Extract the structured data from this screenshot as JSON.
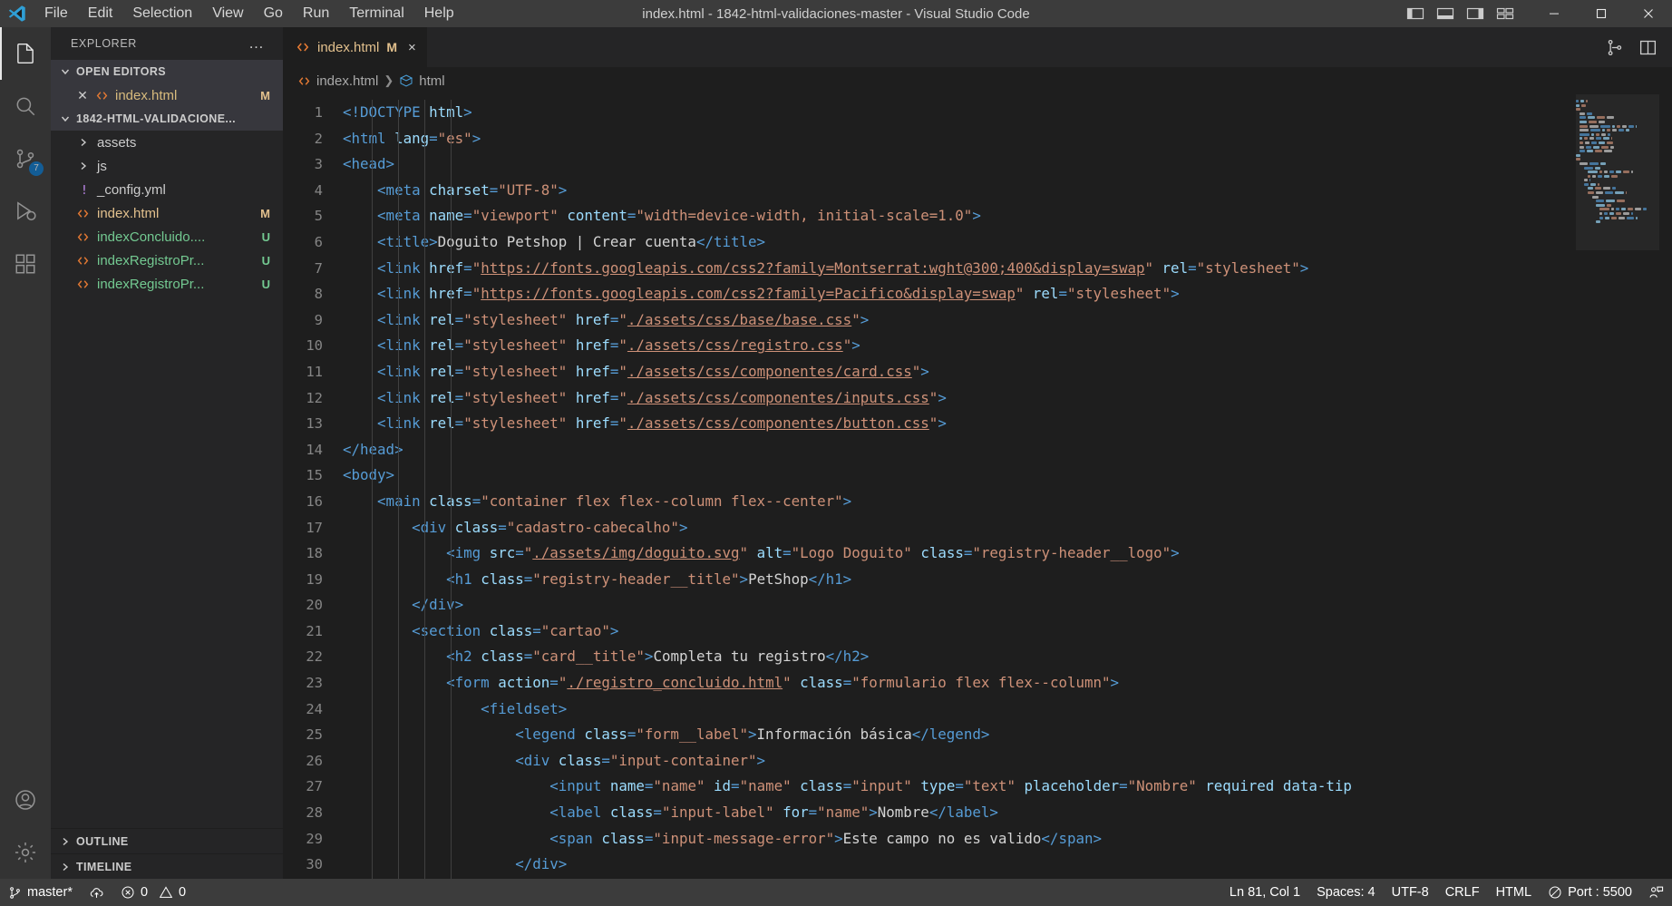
{
  "window": {
    "title": "index.html - 1842-html-validaciones-master - Visual Studio Code",
    "menu": [
      "File",
      "Edit",
      "Selection",
      "View",
      "Go",
      "Run",
      "Terminal",
      "Help"
    ],
    "controls": {
      "minimize": "minimize-icon",
      "maximize": "maximize-icon",
      "close": "close-icon"
    },
    "layout_icons": [
      "toggle-primary-sidebar-icon",
      "toggle-panel-icon",
      "toggle-secondary-sidebar-icon",
      "customize-layout-icon"
    ]
  },
  "activitybar": {
    "items": [
      {
        "name": "explorer",
        "icon": "files-icon",
        "active": true,
        "badge": ""
      },
      {
        "name": "search",
        "icon": "search-icon",
        "active": false,
        "badge": ""
      },
      {
        "name": "source-control",
        "icon": "source-control-icon",
        "active": false,
        "badge": "7"
      },
      {
        "name": "run-and-debug",
        "icon": "run-debug-icon",
        "active": false,
        "badge": ""
      },
      {
        "name": "extensions",
        "icon": "extensions-icon",
        "active": false,
        "badge": ""
      }
    ],
    "bottom": [
      {
        "name": "accounts",
        "icon": "account-icon"
      },
      {
        "name": "manage",
        "icon": "gear-icon"
      }
    ]
  },
  "sidebar": {
    "title": "EXPLORER",
    "more_label": "…",
    "open_editors": {
      "label": "OPEN EDITORS",
      "items": [
        {
          "name": "index.html",
          "badge": "M",
          "badge_class": "c-mod",
          "icon": "html-file-icon"
        }
      ]
    },
    "workspace": {
      "label": "1842-HTML-VALIDACIONE...",
      "items": [
        {
          "name": "assets",
          "badge": "",
          "badge_class": "",
          "icon": "folder-chevron-icon",
          "kind": "folder"
        },
        {
          "name": "js",
          "badge": "",
          "badge_class": "",
          "icon": "folder-chevron-icon",
          "kind": "folder"
        },
        {
          "name": "_config.yml",
          "badge": "",
          "badge_class": "",
          "icon": "yaml-file-icon",
          "kind": "file"
        },
        {
          "name": "index.html",
          "badge": "M",
          "badge_class": "c-mod",
          "icon": "html-file-icon",
          "kind": "file"
        },
        {
          "name": "indexConcluido....",
          "badge": "U",
          "badge_class": "c-untr",
          "icon": "html-file-icon",
          "kind": "file"
        },
        {
          "name": "indexRegistroPr...",
          "badge": "U",
          "badge_class": "c-untr",
          "icon": "html-file-icon",
          "kind": "file"
        },
        {
          "name": "indexRegistroPr...",
          "badge": "U",
          "badge_class": "c-untr",
          "icon": "html-file-icon",
          "kind": "file"
        }
      ]
    },
    "sections": [
      {
        "label": "OUTLINE"
      },
      {
        "label": "TIMELINE"
      }
    ]
  },
  "editor": {
    "tab": {
      "label": "index.html",
      "dirty_badge": "M",
      "close": "×",
      "icon": "html-file-icon"
    },
    "tab_actions": [
      "split-editor-icon",
      "more-actions-icon"
    ],
    "breadcrumbs": [
      {
        "label": "index.html",
        "icon": "html-file-icon"
      },
      {
        "label": "html",
        "icon": "symbol-html-icon"
      }
    ],
    "first_line": 1,
    "lines": [
      {
        "n": 1,
        "indent": 0,
        "html": "<span class=\"t\">&lt;!</span><span class=\"t\">DOCTYPE </span><span class=\"a\">html</span><span class=\"t\">&gt;</span>"
      },
      {
        "n": 2,
        "indent": 0,
        "html": "<span class=\"t\">&lt;html</span> <span class=\"a\">lang</span><span class=\"t\">=</span><span class=\"s\">\"es\"</span><span class=\"t\">&gt;</span>"
      },
      {
        "n": 3,
        "indent": 0,
        "html": "<span class=\"t\">&lt;head&gt;</span>"
      },
      {
        "n": 4,
        "indent": 1,
        "html": "    <span class=\"t\">&lt;meta</span> <span class=\"a\">charset</span><span class=\"t\">=</span><span class=\"s\">\"UTF-8\"</span><span class=\"t\">&gt;</span>"
      },
      {
        "n": 5,
        "indent": 1,
        "html": "    <span class=\"t\">&lt;meta</span> <span class=\"a\">name</span><span class=\"t\">=</span><span class=\"s\">\"viewport\"</span> <span class=\"a\">content</span><span class=\"t\">=</span><span class=\"s\">\"width=device-width, initial-scale=1.0\"</span><span class=\"t\">&gt;</span>"
      },
      {
        "n": 6,
        "indent": 1,
        "html": "    <span class=\"t\">&lt;title&gt;</span><span class=\"txt\">Doguito Petshop | Crear cuenta</span><span class=\"t\">&lt;/title&gt;</span>"
      },
      {
        "n": 7,
        "indent": 1,
        "html": "    <span class=\"t\">&lt;link</span> <span class=\"a\">href</span><span class=\"t\">=</span><span class=\"s\">\"</span><span class=\"s2\">https://fonts.googleapis.com/css2?family=Montserrat:wght@300;400&amp;display=swap</span><span class=\"s\">\"</span> <span class=\"a\">rel</span><span class=\"t\">=</span><span class=\"s\">\"stylesheet\"</span><span class=\"t\">&gt;</span>"
      },
      {
        "n": 8,
        "indent": 1,
        "html": "    <span class=\"t\">&lt;link</span> <span class=\"a\">href</span><span class=\"t\">=</span><span class=\"s\">\"</span><span class=\"s2\">https://fonts.googleapis.com/css2?family=Pacifico&amp;display=swap</span><span class=\"s\">\"</span> <span class=\"a\">rel</span><span class=\"t\">=</span><span class=\"s\">\"stylesheet\"</span><span class=\"t\">&gt;</span>"
      },
      {
        "n": 9,
        "indent": 1,
        "html": "    <span class=\"t\">&lt;link</span> <span class=\"a\">rel</span><span class=\"t\">=</span><span class=\"s\">\"stylesheet\"</span> <span class=\"a\">href</span><span class=\"t\">=</span><span class=\"s\">\"</span><span class=\"s2\">./assets/css/base/base.css</span><span class=\"s\">\"</span><span class=\"t\">&gt;</span>"
      },
      {
        "n": 10,
        "indent": 1,
        "html": "    <span class=\"t\">&lt;link</span> <span class=\"a\">rel</span><span class=\"t\">=</span><span class=\"s\">\"stylesheet\"</span> <span class=\"a\">href</span><span class=\"t\">=</span><span class=\"s\">\"</span><span class=\"s2\">./assets/css/registro.css</span><span class=\"s\">\"</span><span class=\"t\">&gt;</span>"
      },
      {
        "n": 11,
        "indent": 1,
        "html": "    <span class=\"t\">&lt;link</span> <span class=\"a\">rel</span><span class=\"t\">=</span><span class=\"s\">\"stylesheet\"</span> <span class=\"a\">href</span><span class=\"t\">=</span><span class=\"s\">\"</span><span class=\"s2\">./assets/css/componentes/card.css</span><span class=\"s\">\"</span><span class=\"t\">&gt;</span>"
      },
      {
        "n": 12,
        "indent": 1,
        "html": "    <span class=\"t\">&lt;link</span> <span class=\"a\">rel</span><span class=\"t\">=</span><span class=\"s\">\"stylesheet\"</span> <span class=\"a\">href</span><span class=\"t\">=</span><span class=\"s\">\"</span><span class=\"s2\">./assets/css/componentes/inputs.css</span><span class=\"s\">\"</span><span class=\"t\">&gt;</span>"
      },
      {
        "n": 13,
        "indent": 1,
        "html": "    <span class=\"t\">&lt;link</span> <span class=\"a\">rel</span><span class=\"t\">=</span><span class=\"s\">\"stylesheet\"</span> <span class=\"a\">href</span><span class=\"t\">=</span><span class=\"s\">\"</span><span class=\"s2\">./assets/css/componentes/button.css</span><span class=\"s\">\"</span><span class=\"t\">&gt;</span>"
      },
      {
        "n": 14,
        "indent": 0,
        "html": "<span class=\"t\">&lt;/head&gt;</span>"
      },
      {
        "n": 15,
        "indent": 0,
        "html": "<span class=\"t\">&lt;body&gt;</span>"
      },
      {
        "n": 16,
        "indent": 1,
        "html": "    <span class=\"t\">&lt;main</span> <span class=\"a\">class</span><span class=\"t\">=</span><span class=\"s\">\"container flex flex--column flex--center\"</span><span class=\"t\">&gt;</span>"
      },
      {
        "n": 17,
        "indent": 2,
        "html": "        <span class=\"t\">&lt;div</span> <span class=\"a\">class</span><span class=\"t\">=</span><span class=\"s\">\"cadastro-cabecalho\"</span><span class=\"t\">&gt;</span>"
      },
      {
        "n": 18,
        "indent": 3,
        "html": "            <span class=\"t\">&lt;img</span> <span class=\"a\">src</span><span class=\"t\">=</span><span class=\"s\">\"</span><span class=\"s2\">./assets/img/doguito.svg</span><span class=\"s\">\"</span> <span class=\"a\">alt</span><span class=\"t\">=</span><span class=\"s\">\"Logo Doguito\"</span> <span class=\"a\">class</span><span class=\"t\">=</span><span class=\"s\">\"registry-header__logo\"</span><span class=\"t\">&gt;</span>"
      },
      {
        "n": 19,
        "indent": 3,
        "html": "            <span class=\"t\">&lt;h1</span> <span class=\"a\">class</span><span class=\"t\">=</span><span class=\"s\">\"registry-header__title\"</span><span class=\"t\">&gt;</span><span class=\"txt\">PetShop</span><span class=\"t\">&lt;/h1&gt;</span>"
      },
      {
        "n": 20,
        "indent": 2,
        "html": "        <span class=\"t\">&lt;/div&gt;</span>"
      },
      {
        "n": 21,
        "indent": 2,
        "html": "        <span class=\"t\">&lt;section</span> <span class=\"a\">class</span><span class=\"t\">=</span><span class=\"s\">\"cartao\"</span><span class=\"t\">&gt;</span>"
      },
      {
        "n": 22,
        "indent": 3,
        "html": "            <span class=\"t\">&lt;h2</span> <span class=\"a\">class</span><span class=\"t\">=</span><span class=\"s\">\"card__title\"</span><span class=\"t\">&gt;</span><span class=\"txt\">Completa tu registro</span><span class=\"t\">&lt;/h2&gt;</span>"
      },
      {
        "n": 23,
        "indent": 3,
        "html": "            <span class=\"t\">&lt;form</span> <span class=\"a\">action</span><span class=\"t\">=</span><span class=\"s\">\"</span><span class=\"s2\">./registro_concluido.html</span><span class=\"s\">\"</span> <span class=\"a\">class</span><span class=\"t\">=</span><span class=\"s\">\"formulario flex flex--column\"</span><span class=\"t\">&gt;</span>"
      },
      {
        "n": 24,
        "indent": 4,
        "html": "                <span class=\"t\">&lt;fieldset&gt;</span>"
      },
      {
        "n": 25,
        "indent": 5,
        "html": "                    <span class=\"t\">&lt;legend</span> <span class=\"a\">class</span><span class=\"t\">=</span><span class=\"s\">\"form__label\"</span><span class=\"t\">&gt;</span><span class=\"txt\">Información básica</span><span class=\"t\">&lt;/legend&gt;</span>"
      },
      {
        "n": 26,
        "indent": 5,
        "html": "                    <span class=\"t\">&lt;div</span> <span class=\"a\">class</span><span class=\"t\">=</span><span class=\"s\">\"input-container\"</span><span class=\"t\">&gt;</span>"
      },
      {
        "n": 27,
        "indent": 6,
        "html": "                        <span class=\"t\">&lt;input</span> <span class=\"a\">name</span><span class=\"t\">=</span><span class=\"s\">\"name\"</span> <span class=\"a\">id</span><span class=\"t\">=</span><span class=\"s\">\"name\"</span> <span class=\"a\">class</span><span class=\"t\">=</span><span class=\"s\">\"input\"</span> <span class=\"a\">type</span><span class=\"t\">=</span><span class=\"s\">\"text\"</span> <span class=\"a\">placeholder</span><span class=\"t\">=</span><span class=\"s\">\"Nombre\"</span> <span class=\"a\">required</span> <span class=\"a\">data-tip</span>"
      },
      {
        "n": 28,
        "indent": 6,
        "html": "                        <span class=\"t\">&lt;label</span> <span class=\"a\">class</span><span class=\"t\">=</span><span class=\"s\">\"input-label\"</span> <span class=\"a\">for</span><span class=\"t\">=</span><span class=\"s\">\"name\"</span><span class=\"t\">&gt;</span><span class=\"txt\">Nombre</span><span class=\"t\">&lt;/label&gt;</span>"
      },
      {
        "n": 29,
        "indent": 6,
        "html": "                        <span class=\"t\">&lt;span</span> <span class=\"a\">class</span><span class=\"t\">=</span><span class=\"s\">\"input-message-error\"</span><span class=\"t\">&gt;</span><span class=\"txt\">Este campo no es valido</span><span class=\"t\">&lt;/span&gt;</span>"
      },
      {
        "n": 30,
        "indent": 5,
        "html": "                    <span class=\"t\">&lt;/div&gt;</span>"
      }
    ]
  },
  "statusbar": {
    "left": [
      {
        "name": "branch",
        "icon": "source-control-icon",
        "label": "master*"
      },
      {
        "name": "sync",
        "icon": "cloud-upload-icon",
        "label": ""
      },
      {
        "name": "problems",
        "icon": "error-warning-icons",
        "label": "0",
        "label2": "0"
      }
    ],
    "right": [
      {
        "name": "cursor-position",
        "label": "Ln 81, Col 1"
      },
      {
        "name": "indentation",
        "label": "Spaces: 4"
      },
      {
        "name": "encoding",
        "label": "UTF-8"
      },
      {
        "name": "eol",
        "label": "CRLF"
      },
      {
        "name": "language-mode",
        "label": "HTML"
      },
      {
        "name": "live-server-port",
        "icon": "circle-slash-icon",
        "label": "Port : 5500"
      },
      {
        "name": "feedback",
        "icon": "feedback-icon",
        "label": ""
      }
    ]
  },
  "colors": {
    "accent": "#0078d4",
    "titlebar_bg": "#3c3c3c",
    "sidebar_bg": "#252526",
    "editor_bg": "#1e1e1e",
    "modified": "#e2c08d",
    "untracked": "#73c991"
  }
}
